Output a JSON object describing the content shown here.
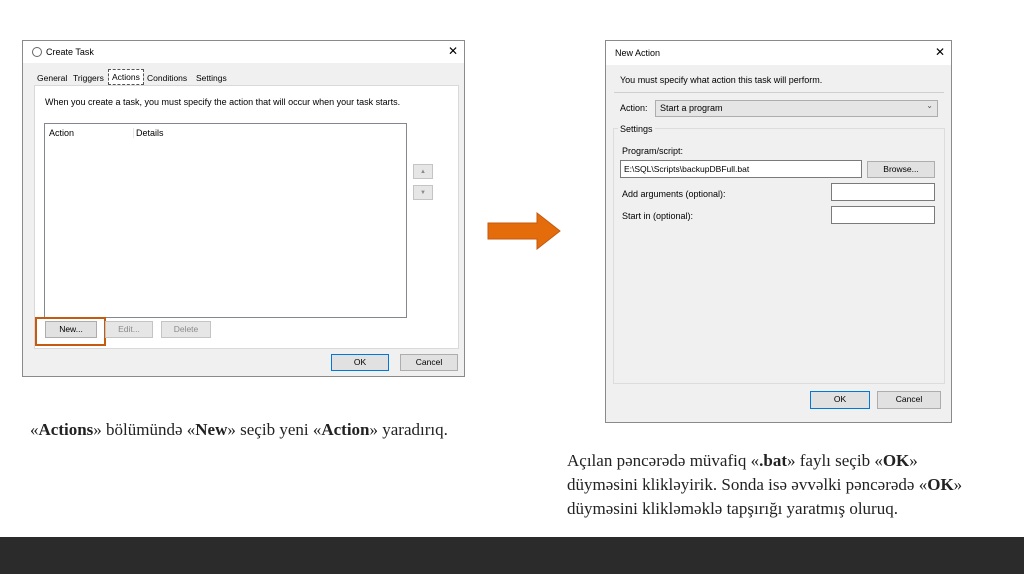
{
  "create_task": {
    "title": "Create Task",
    "tabs": [
      "General",
      "Triggers",
      "Actions",
      "Conditions",
      "Settings"
    ],
    "active_tab": "Actions",
    "description": "When you create a task, you must specify the action that will occur when your task starts.",
    "columns": [
      "Action",
      "Details"
    ],
    "new_label": "New...",
    "edit_label": "Edit...",
    "delete_label": "Delete",
    "ok_label": "OK",
    "cancel_label": "Cancel",
    "up_icon": "▲",
    "down_icon": "▼",
    "close": "✕"
  },
  "new_action": {
    "title": "New Action",
    "message": "You must specify what action this task will perform.",
    "action_label": "Action:",
    "action_value": "Start a program",
    "settings_label": "Settings",
    "program_label": "Program/script:",
    "program_value": "E:\\SQL\\Scripts\\backupDBFull.bat",
    "browse_label": "Browse...",
    "args_label": "Add arguments (optional):",
    "start_label": "Start in (optional):",
    "ok_label": "OK",
    "cancel_label": "Cancel",
    "close": "✕"
  },
  "captions": {
    "left": [
      "«",
      "Actions",
      "» bölümündə «",
      "New",
      "» seçib yeni «",
      "Action",
      "» yaradırıq."
    ],
    "right": [
      "Açılan pəncərədə müvafiq «",
      ".bat",
      "» faylı seçib «",
      "OK",
      "» düyməsini klikləyirik. Sonda isə əvvəlki pəncərədə «",
      "OK",
      "» düyməsini klikləməklə tapşırığı yaratmış oluruq."
    ]
  },
  "colors": {
    "arrow": "#e46c0a",
    "highlight": "#c55a11",
    "footer": "#2b2b2b"
  }
}
